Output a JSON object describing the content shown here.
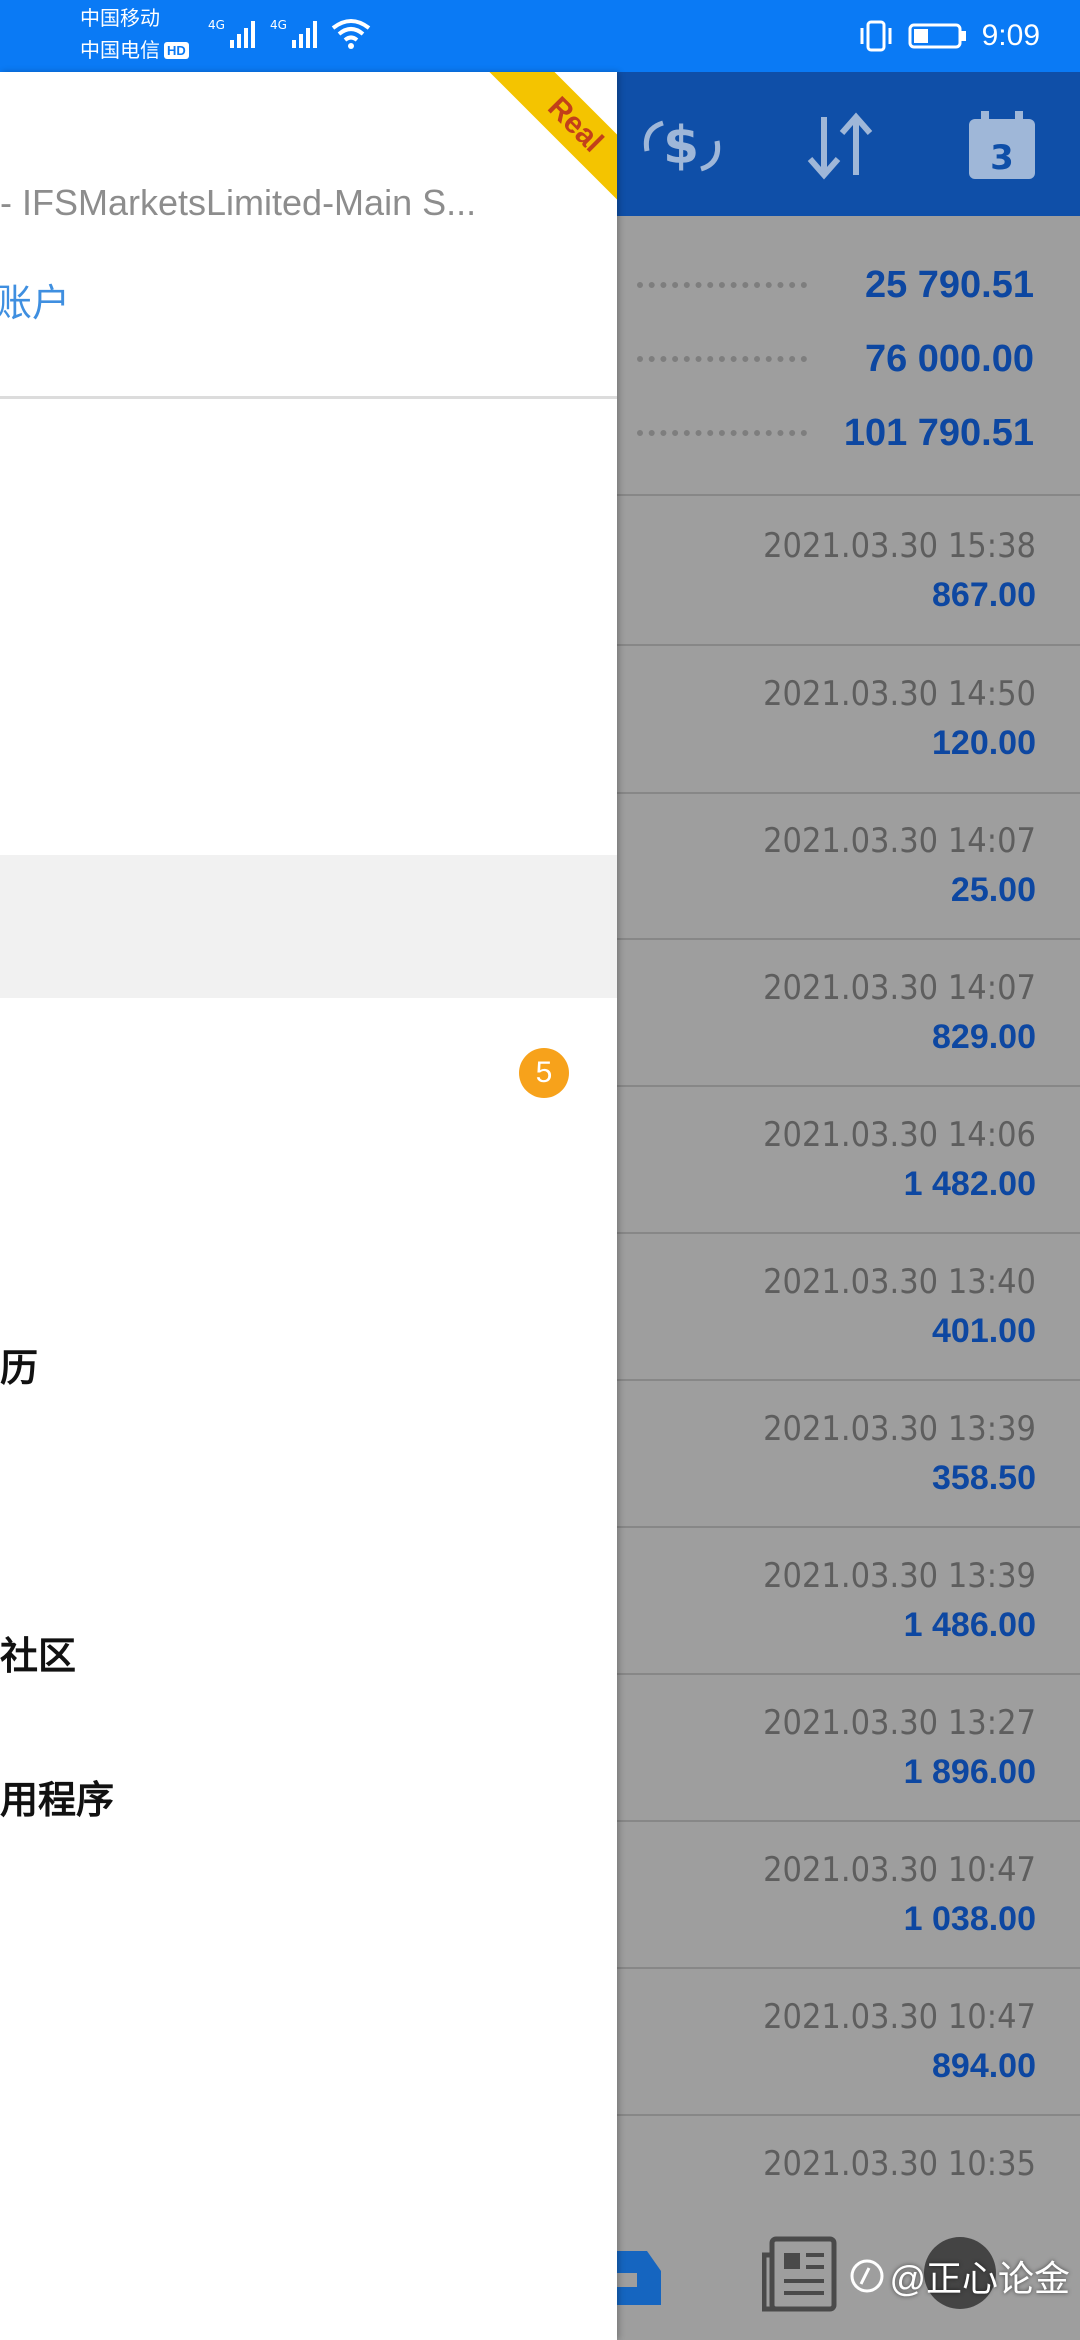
{
  "status_bar": {
    "carrier_1": "中国移动",
    "carrier_2": "中国电信",
    "hd": "HD",
    "net_1": "4G",
    "net_2": "4G",
    "time": "9:09"
  },
  "drawer": {
    "ribbon": "Real",
    "account_server": "- IFSMarketsLimited-Main S...",
    "account_link": "账户",
    "badge_count": "5",
    "menu": [
      {
        "label": "历"
      },
      {
        "label": "社区"
      },
      {
        "label": "用程序"
      }
    ]
  },
  "toolbar": {
    "calendar_day": "3"
  },
  "summary": [
    {
      "value": "25 790.51"
    },
    {
      "value": "76 000.00"
    },
    {
      "value": "101 790.51"
    }
  ],
  "deals": [
    {
      "time": "2021.03.30 15:38",
      "amount": "867.00"
    },
    {
      "time": "2021.03.30 14:50",
      "amount": "120.00"
    },
    {
      "time": "2021.03.30 14:07",
      "amount": "25.00"
    },
    {
      "time": "2021.03.30 14:07",
      "amount": "829.00"
    },
    {
      "time": "2021.03.30 14:06",
      "amount": "1 482.00"
    },
    {
      "time": "2021.03.30 13:40",
      "amount": "401.00"
    },
    {
      "time": "2021.03.30 13:39",
      "amount": "358.50"
    },
    {
      "time": "2021.03.30 13:39",
      "amount": "1 486.00"
    },
    {
      "time": "2021.03.30 13:27",
      "amount": "1 896.00"
    },
    {
      "time": "2021.03.30 10:47",
      "amount": "1 038.00"
    },
    {
      "time": "2021.03.30 10:47",
      "amount": "894.00"
    },
    {
      "time": "2021.03.30 10:35",
      "amount": ""
    }
  ],
  "watermark": "@正心论金",
  "colors": {
    "status_bar": "#0a7af5",
    "toolbar": "#0f4fa8",
    "amount_blue": "#0d47a1",
    "badge": "#f7a21b",
    "ribbon": "#f4c400",
    "scrim": "#9e9e9e"
  }
}
